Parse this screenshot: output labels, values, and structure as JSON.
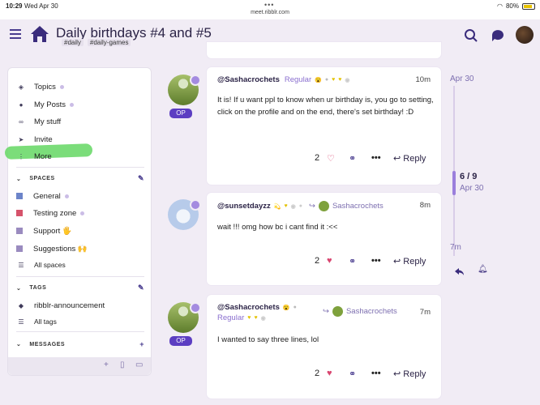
{
  "status_bar": {
    "time": "10:29",
    "date": "Wed Apr 30",
    "url": "meet.ribblr.com",
    "battery": "80%"
  },
  "header": {
    "title": "Daily birthdays #4 and #5",
    "tags": [
      "#daily",
      "#daily-games"
    ]
  },
  "sidebar": {
    "nav": [
      {
        "label": "Topics",
        "icon": "layers-icon"
      },
      {
        "label": "My Posts",
        "icon": "user-icon"
      },
      {
        "label": "My stuff",
        "icon": "link-icon"
      },
      {
        "label": "Invite",
        "icon": "send-icon"
      },
      {
        "label": "More",
        "icon": "more-icon"
      }
    ],
    "spaces_header": "SPACES",
    "spaces": [
      {
        "label": "General",
        "color": "#6c84c9"
      },
      {
        "label": "Testing zone",
        "color": "#d6536b"
      },
      {
        "label": "Support 🖐",
        "color": "#9a8bbf"
      },
      {
        "label": "Suggestions 🙌",
        "color": "#9a8bbf"
      }
    ],
    "all_spaces": "All spaces",
    "tags_header": "TAGS",
    "tags": [
      "ribblr-announcement"
    ],
    "all_tags": "All tags",
    "messages_header": "MESSAGES"
  },
  "timeline": {
    "top_date": "Apr 30",
    "count": "6 / 9",
    "current_date": "Apr 30",
    "bottom_label": "7m"
  },
  "posts": [
    {
      "username": "@Sashacrochets",
      "flair": "Regular",
      "time": "10m",
      "body": "It is! If u want ppl to know when ur birthday is, you go to setting, click on the profile and on the end, there's set birthday! :D",
      "likes": "2",
      "reply_label": "Reply",
      "op_label": "OP"
    },
    {
      "username": "@sunsetdayzz",
      "reply_to": "Sashacrochets",
      "time": "8m",
      "body": "wait !!! omg how bc i cant find it :<<",
      "likes": "2",
      "reply_label": "Reply"
    },
    {
      "username": "@Sashacrochets",
      "flair": "Regular",
      "reply_to": "Sashacrochets",
      "time": "7m",
      "body": "I wanted to say three lines, lol",
      "likes": "2",
      "reply_label": "Reply",
      "op_label": "OP"
    }
  ]
}
